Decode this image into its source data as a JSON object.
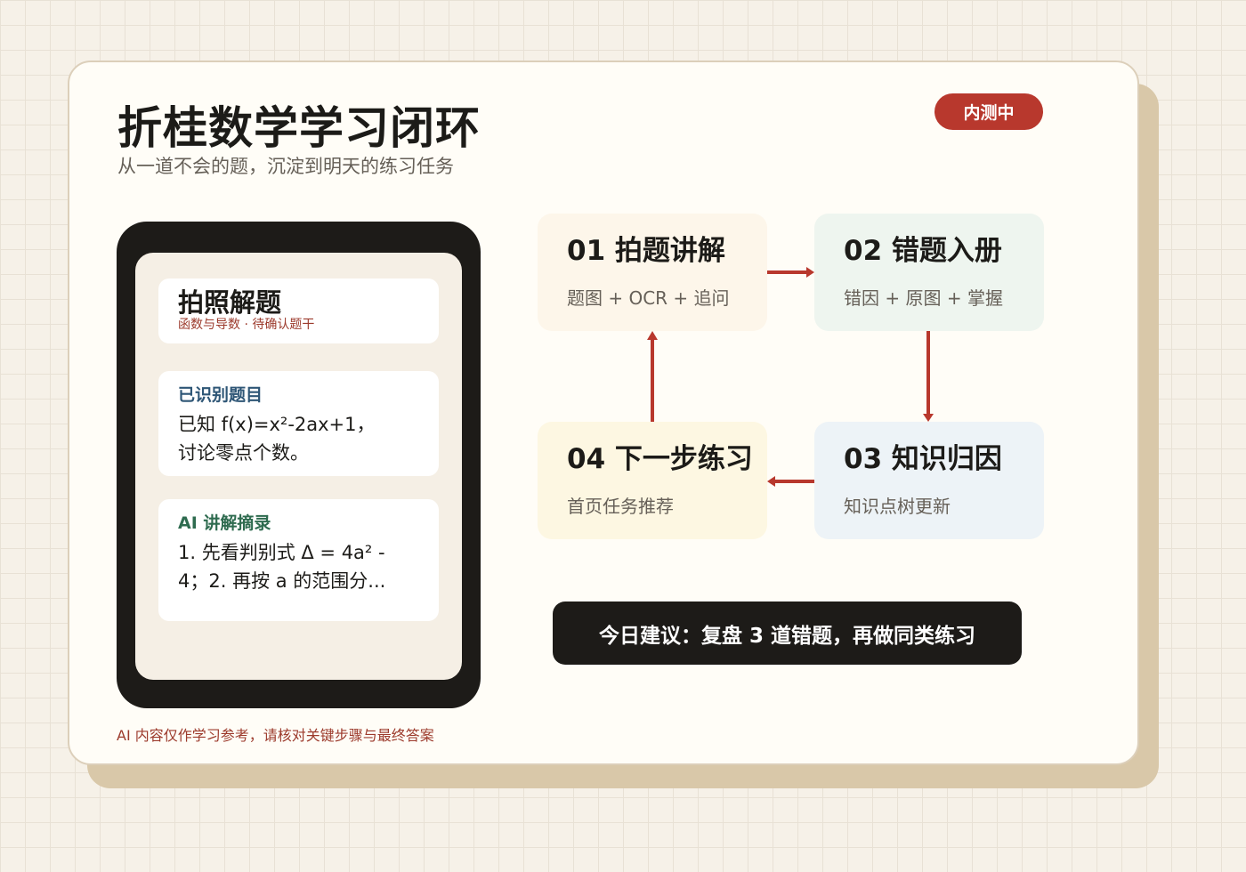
{
  "header": {
    "title": "折桂数学学习闭环",
    "subtitle": "从一道不会的题，沉淀到明天的练习任务",
    "badge": "内测中"
  },
  "phone": {
    "photo_card": {
      "title": "拍照解题",
      "subtitle": "函数与导数 · 待确认题干"
    },
    "recognized_card": {
      "heading": "已识别题目",
      "line1": "已知 f(x)=x²-2ax+1，",
      "line2": "讨论零点个数。"
    },
    "ai_card": {
      "heading": "AI 讲解摘录",
      "line1": "1. 先看判别式 Δ = 4a² -",
      "line2": "4；2. 再按 a 的范围分..."
    }
  },
  "steps": [
    {
      "title": "01 拍题讲解",
      "desc": "题图 + OCR + 追问"
    },
    {
      "title": "02 错题入册",
      "desc": "错因 + 原图 + 掌握"
    },
    {
      "title": "03 知识归因",
      "desc": "知识点树更新"
    },
    {
      "title": "04 下一步练习",
      "desc": "首页任务推荐"
    }
  ],
  "suggestion": "今日建议：复盘 3 道错题，再做同类练习",
  "disclaimer": "AI 内容仅作学习参考，请核对关键步骤与最终答案",
  "colors": {
    "accent": "#b8382d",
    "dark": "#1d1b18",
    "background": "#f6f1e8",
    "card": "#fffdf7"
  }
}
